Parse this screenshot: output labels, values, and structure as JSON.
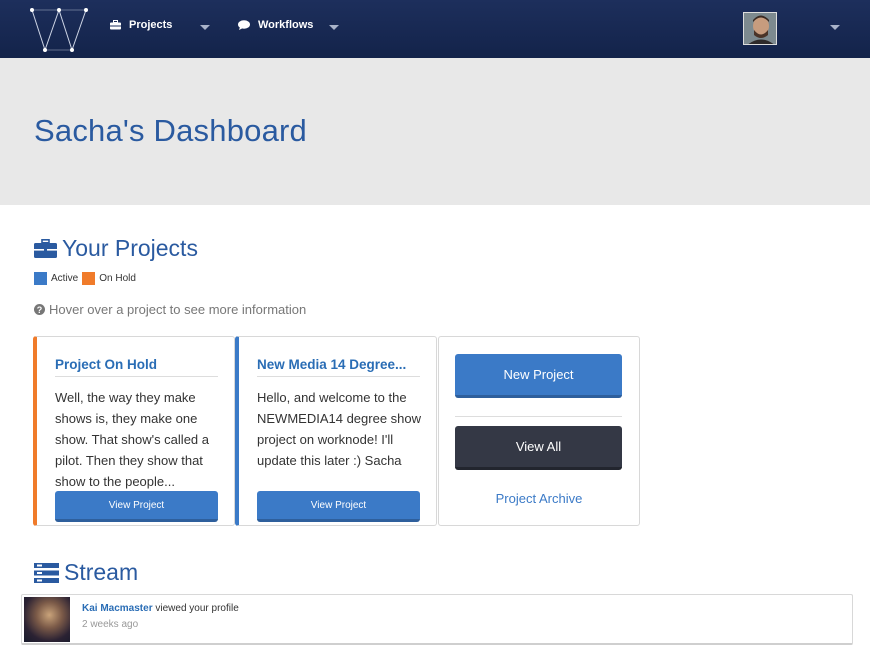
{
  "colors": {
    "navbar": "#1d2f5c",
    "accent": "#2a5aa0",
    "active": "#3b7ac7",
    "on_hold": "#f07b2a",
    "dark_button": "#343845",
    "header_band": "#e8e8e8"
  },
  "nav": {
    "logo_icon": "w-logo-icon",
    "projects_label": "Projects",
    "projects_icon": "briefcase-icon",
    "workflows_label": "Workflows",
    "workflows_icon": "comment-icon"
  },
  "header": {
    "title": "Sacha's Dashboard"
  },
  "projects_section": {
    "heading": "Your Projects",
    "icon": "briefcase-icon",
    "legend": [
      {
        "label": "Active",
        "color": "#3b7ac7"
      },
      {
        "label": "On Hold",
        "color": "#f07b2a"
      }
    ],
    "hint": "Hover over a project to see more information",
    "cards": [
      {
        "title": "Project On Hold",
        "status": "on_hold",
        "body": "Well, the way they make shows is, they make one show. That show's called a pilot. Then they show that show to the people...",
        "button": "View Project"
      },
      {
        "title": "New Media 14 Degree...",
        "status": "active",
        "body": "Hello, and welcome to the NEWMEDIA14 degree show project on worknode! I'll update this later :) Sacha",
        "button": "View Project"
      }
    ],
    "actions": {
      "new_project": "New Project",
      "view_all": "View All",
      "archive": "Project Archive"
    }
  },
  "stream_section": {
    "heading": "Stream",
    "icon": "stream-list-icon",
    "items": [
      {
        "user": "Kai Macmaster",
        "action": "viewed your profile",
        "time": "2 weeks ago"
      }
    ]
  }
}
